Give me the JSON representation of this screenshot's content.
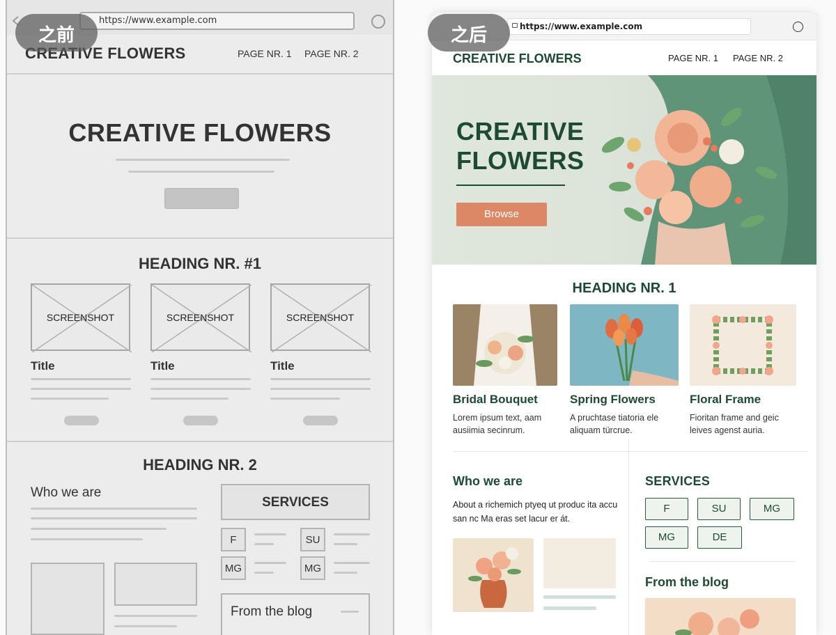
{
  "labels": {
    "before": "之前",
    "after": "之后"
  },
  "before": {
    "url": "https://www.example.com",
    "brand": "CREATIVE FLOWERS",
    "nav": [
      "PAGE NR. 1",
      "PAGE NR. 2"
    ],
    "hero_title": "CREATIVE FLOWERS",
    "heading1": "HEADING NR. #1",
    "screenshot_label": "SCREENSHOT",
    "card_title": "Title",
    "heading2": "HEADING NR. 2",
    "who": "Who we are",
    "services": "SERVICES",
    "tags": [
      "F",
      "SU",
      "MG",
      "MG"
    ],
    "blog": "From the blog"
  },
  "after": {
    "url": "https://www.example.com",
    "brand": "CREATIVE FLOWERS",
    "nav": [
      "PAGE NR. 1",
      "PAGE NR. 2"
    ],
    "hero_title": "CREATIVE FLOWERS",
    "browse": "Browse",
    "heading1": "HEADING NR. 1",
    "cards": [
      {
        "title": "Bridal Bouquet",
        "text": "Lorem ipsum text, aam ausiimia secinrum."
      },
      {
        "title": "Spring Flowers",
        "text": "A pruchtase tiatoria ele aliquam türcrue."
      },
      {
        "title": "Floral Frame",
        "text": "Fioritan frame and geic leives agenst auria."
      }
    ],
    "who": "Who we are",
    "who_text": "About a richemich ptyeq ut produc ita accu san nc Ma eras set lacur er át.",
    "services": "SERVICES",
    "tags": [
      "F",
      "SU",
      "MG",
      "MG",
      "DE"
    ],
    "blog": "From the blog"
  },
  "colors": {
    "accent": "#1d4a32",
    "button": "#dc8765",
    "wireframe": "#ececec"
  }
}
